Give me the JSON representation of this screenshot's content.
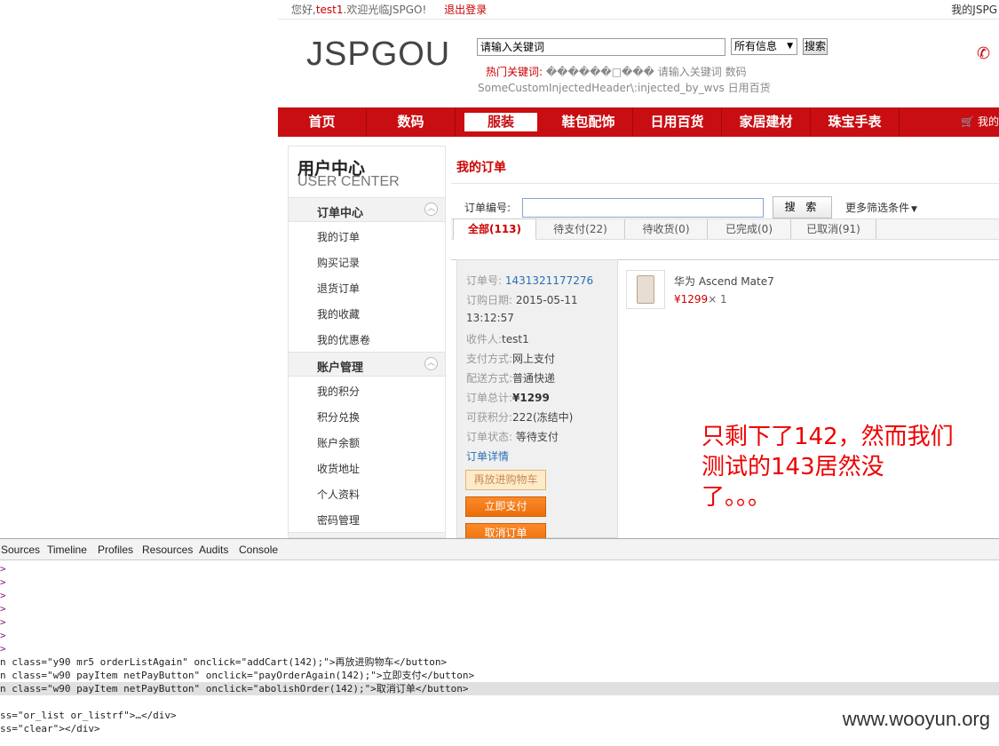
{
  "topbar": {
    "greeting_prefix": "您好,",
    "username": "test1",
    "greeting_suffix": ".欢迎光临JSPGO!",
    "logout": "退出登录",
    "my_account": "我的JSPG"
  },
  "header": {
    "logo": "JSPGOU",
    "search_value": "请输入关键词",
    "search_scope": "所有信息",
    "search_button": "搜索",
    "hotwords_label": "热门关键词:",
    "hotwords": "������□��� 请输入关键词 数码",
    "injected_line": "SomeCustomInjectedHeader\\:injected_by_wvs 日用百货"
  },
  "nav": {
    "items": [
      {
        "label": "首页"
      },
      {
        "label": "数码"
      },
      {
        "label": "服装"
      },
      {
        "label": "鞋包配饰"
      },
      {
        "label": "日用百货"
      },
      {
        "label": "家居建材"
      },
      {
        "label": "珠宝手表"
      }
    ],
    "cart": "🛒 我的"
  },
  "sidebar": {
    "title": "用户中心",
    "subtitle": "USER CENTER",
    "group1": "订单中心",
    "group1_items": [
      "我的订单",
      "购买记录",
      "退货订单",
      "我的收藏",
      "我的优惠卷"
    ],
    "group2": "账户管理",
    "group2_items": [
      "我的积分",
      "积分兑换",
      "账户余额",
      "收货地址",
      "个人资料",
      "密码管理"
    ]
  },
  "main": {
    "title": "我的订单",
    "order_no_label": "订单编号:",
    "search_button": "搜 索",
    "more_filters": "更多筛选条件",
    "tabs": [
      "全部(113)",
      "待支付(22)",
      "待收货(0)",
      "已完成(0)",
      "已取消(91)"
    ]
  },
  "order": {
    "no_label": "订单号:",
    "no_value": "1431321177276",
    "date_label": "订购日期:",
    "date_value": "2015-05-11",
    "time_value": "13:12:57",
    "receiver_label": "收件人:",
    "receiver_value": "test1",
    "pay_label": "支付方式:",
    "pay_value": "网上支付",
    "ship_label": "配送方式:",
    "ship_value": "普通快递",
    "total_label": "订单总计:",
    "total_value": "¥1299",
    "points_label": "可获积分:",
    "points_value": "222(冻结中)",
    "status_label": "订单状态:",
    "status_value": "等待支付",
    "detail_link": "订单详情",
    "btn_again": "再放进购物车",
    "btn_pay": "立即支付",
    "btn_cancel": "取消订单",
    "product_name": "华为 Ascend Mate7",
    "product_price": "¥1299",
    "product_qty": "× 1"
  },
  "annotation": {
    "line1": "只剩下了142，然而我们",
    "line2": "测试的143居然没",
    "line3": "了。。。"
  },
  "devtools": {
    "tabs": [
      "Sources",
      "Timeline",
      "Profiles",
      "Resources",
      "Audits",
      "Console"
    ],
    "lines": [
      ">",
      ">",
      ">",
      ">",
      ">",
      ">",
      ">",
      "n class=\"y90 mr5 orderListAgain\" onclick=\"addCart(142);\">再放进购物车</button>",
      "n class=\"w90 payItem netPayButton\" onclick=\"payOrderAgain(142);\">立即支付</button>",
      "n class=\"w90 payItem netPayButton\" onclick=\"abolishOrder(142);\">取消订单</button>",
      "",
      "ss=\"or_list or_listrf\">…</div>",
      "ss=\"clear\"></div>"
    ]
  },
  "watermark": "www.wooyun.org"
}
